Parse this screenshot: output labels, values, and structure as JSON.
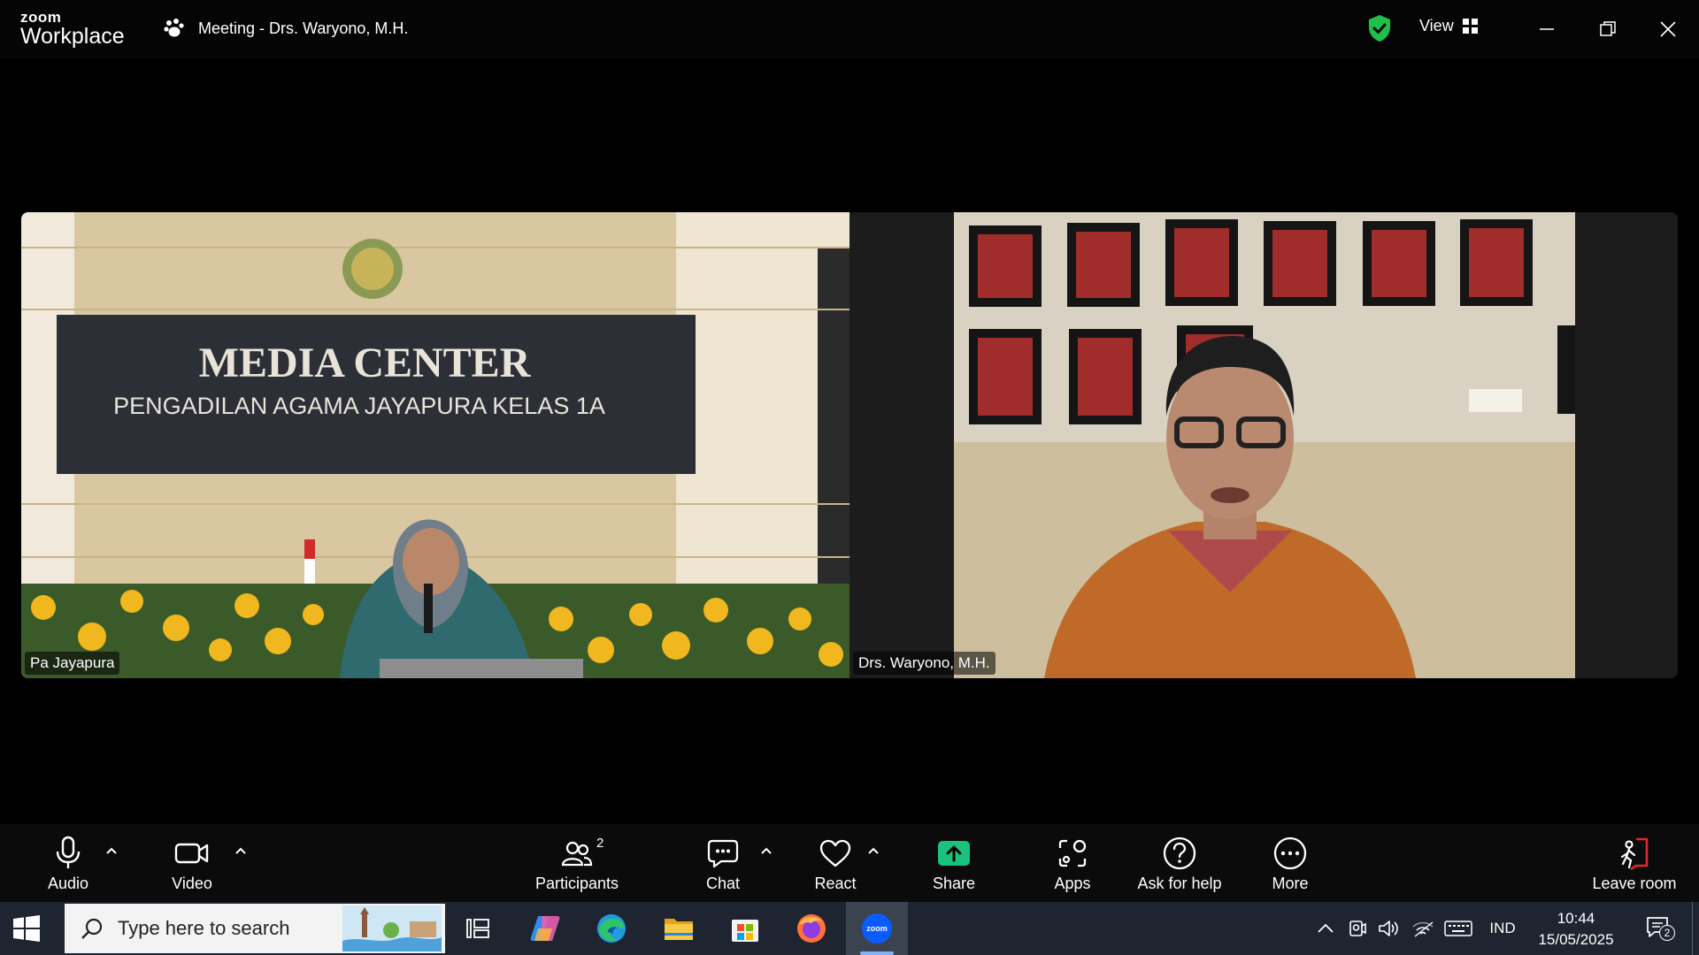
{
  "app": {
    "logo_small": "zoom",
    "logo_big": "Workplace",
    "meeting_title": "Meeting - Drs. Waryono, M.H.",
    "view_label": "View"
  },
  "colors": {
    "shield": "#1fbf4a",
    "share": "#19c37d",
    "leave": "#e02828",
    "taskbar": "#1f2530"
  },
  "participants": [
    {
      "name": "Pa Jayapura",
      "sign_line1": "MEDIA CENTER",
      "sign_line2": "PENGADILAN AGAMA JAYAPURA  KELAS 1A"
    },
    {
      "name": "Drs. Waryono, M.H."
    }
  ],
  "toolbar": {
    "audio": "Audio",
    "video": "Video",
    "participants": "Participants",
    "participants_count": "2",
    "chat": "Chat",
    "react": "React",
    "share": "Share",
    "apps": "Apps",
    "ask_for_help": "Ask for help",
    "more": "More",
    "leave_room": "Leave room"
  },
  "taskbar": {
    "search_placeholder": "Type here to search",
    "language": "IND",
    "time": "10:44",
    "date": "15/05/2025",
    "notification_count": "2",
    "pinned_icons": [
      "task-view-icon",
      "copilot-icon",
      "edge-icon",
      "file-explorer-icon",
      "microsoft-store-icon",
      "firefox-icon",
      "zoom-icon"
    ]
  }
}
